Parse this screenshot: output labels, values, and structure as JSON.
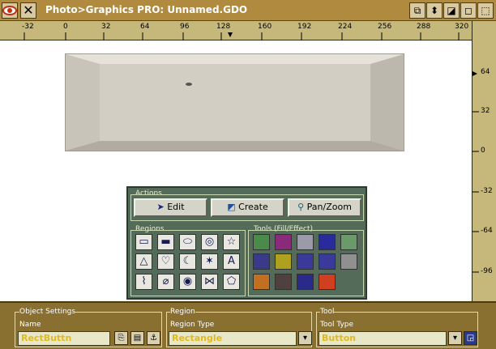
{
  "window": {
    "title": "Photo>Graphics PRO: Unnamed.GDO",
    "close_glyph": "✕",
    "buttons": [
      "⧉",
      "⬍",
      "◪",
      "◻",
      "⬚"
    ]
  },
  "ruler": {
    "horizontal": [
      "-32",
      "0",
      "32",
      "64",
      "96",
      "128",
      "160",
      "192",
      "224",
      "256",
      "288",
      "320"
    ],
    "vertical": [
      "64",
      "32",
      "0",
      "-32",
      "-64",
      "-96"
    ]
  },
  "palette": {
    "actions_label": "Actions",
    "actions": [
      {
        "label": "Edit",
        "icon": "pointer-icon"
      },
      {
        "label": "Create",
        "icon": "create-icon"
      },
      {
        "label": "Pan/Zoom",
        "icon": "magnifier-icon"
      }
    ],
    "regions_label": "Regions",
    "regions": [
      "▭",
      "▬",
      "⬭",
      "◎",
      "☆",
      "△",
      "♡",
      "☾",
      "✶",
      "A",
      "⌇",
      "⌀",
      "◉",
      "⋈",
      "⬠"
    ],
    "tools_label": "Tools (Fill/Effect)",
    "tools": [
      "#4a8a4a",
      "#8a2a7a",
      "#9a9aa8",
      "#2a2a9a",
      "#6a9a6a",
      "#3a3a8a",
      "#b0a020",
      "#3a3a9a",
      "#3a3a9a",
      "#909090",
      "#c07020",
      "#504040",
      "#2a2a8a",
      "#d04020"
    ]
  },
  "bottom": {
    "object": {
      "title": "Object Settings",
      "field_label": "Name",
      "value": "RectButtn"
    },
    "region": {
      "title": "Region",
      "field_label": "Region Type",
      "value": "Rectangle"
    },
    "tool": {
      "title": "Tool",
      "field_label": "Tool Type",
      "value": "Button"
    }
  }
}
